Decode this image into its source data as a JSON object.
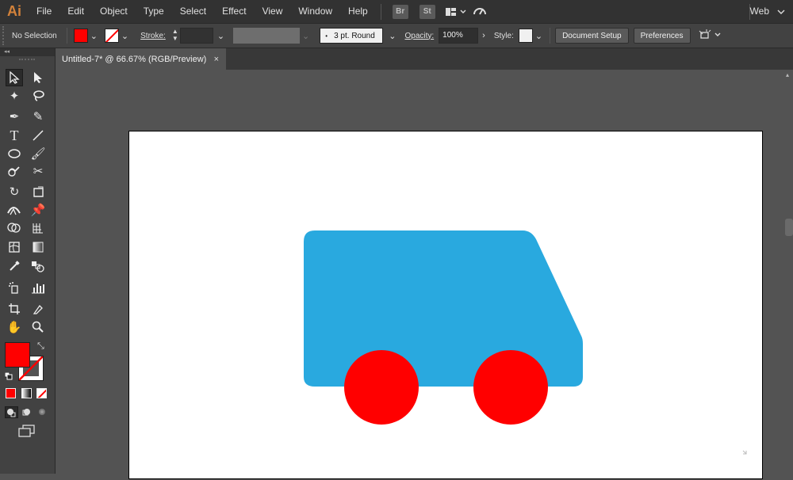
{
  "app": {
    "logo": "Ai"
  },
  "menu": [
    "File",
    "Edit",
    "Object",
    "Type",
    "Select",
    "Effect",
    "View",
    "Window",
    "Help"
  ],
  "bridge": {
    "br": "Br",
    "st": "St"
  },
  "workspace": "Web",
  "control": {
    "selection": "No Selection",
    "stroke_label": "Stroke:",
    "brush": "3 pt. Round",
    "opacity_label": "Opacity:",
    "opacity_value": "100%",
    "style_label": "Style:",
    "doc_setup": "Document Setup",
    "preferences": "Preferences"
  },
  "document": {
    "tab_title": "Untitled-7* @ 66.67% (RGB/Preview)",
    "close": "×"
  },
  "colors": {
    "fill": "#ff0000",
    "truck_body": "#29a9df",
    "wheel": "#ff0000"
  },
  "tools": [
    [
      "selection-icon",
      "direct-selection-icon"
    ],
    [
      "magic-wand-icon",
      "lasso-icon"
    ],
    [
      "pen-icon",
      "curvature-icon"
    ],
    [
      "type-icon",
      "line-icon"
    ],
    [
      "ellipse-icon",
      "paintbrush-icon"
    ],
    [
      "shaper-icon",
      "scissors-icon"
    ],
    [
      "rotate-icon",
      "free-transform-icon"
    ],
    [
      "width-icon",
      "puppet-warp-icon"
    ],
    [
      "shape-builder-icon",
      "perspective-icon"
    ],
    [
      "mesh-icon",
      "gradient-icon"
    ],
    [
      "eyedropper-icon",
      "blend-icon"
    ],
    [
      "symbol-sprayer-icon",
      "column-graph-icon"
    ],
    [
      "artboard-icon",
      "slice-icon"
    ],
    [
      "hand-icon",
      "zoom-icon"
    ]
  ]
}
